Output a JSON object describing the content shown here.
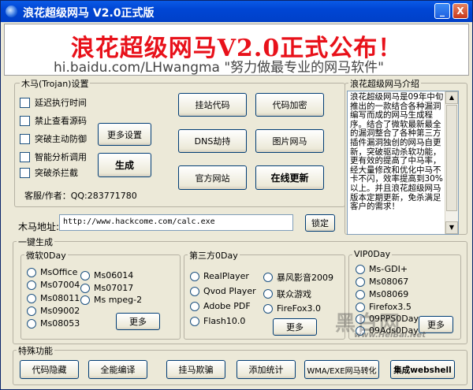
{
  "window": {
    "title": "浪花超级网马 V2.0正式版",
    "minimize_glyph": "_",
    "close_glyph": "X"
  },
  "banner": {
    "headline": "浪花超级网马V2.0正式公布！",
    "subline": "hi.baidu.com/LHwangma  \"努力做最专业的网马软件\"",
    "headline_color": "#e8111a"
  },
  "trojan_settings": {
    "legend": "木马(Trojan)设置",
    "options": [
      {
        "label": "延迟执行时间",
        "checked": false
      },
      {
        "label": "禁止查看源码",
        "checked": false
      },
      {
        "label": "突破主动防御",
        "checked": false
      },
      {
        "label": "智能分析调用",
        "checked": false
      },
      {
        "label": "突破杀拦截",
        "checked": false
      }
    ],
    "more_settings": "更多设置",
    "generate": "生成",
    "author": "客服/作者：QQ:283771780"
  },
  "tools": {
    "hang_code": "挂站代码",
    "encrypt_code": "代码加密",
    "dns_hijack": "DNS劫持",
    "image_trojan": "图片网马",
    "official_site": "官方网站",
    "online_update": "在线更新"
  },
  "intro": {
    "legend": "浪花超级网马介绍",
    "text": "浪花超级网马是09年中旬推出的一款结合各种漏洞编写而成的网马生成程序。结合了微软最新最全的漏洞整合了各种第三方插件漏洞独创的网马自更新，突破驱动杀软功能，更有效的提高了中马率，经大量修改和优化中马不卡不闪，效率提高到30%以上。并且浪花超级网马版本定期更新，免杀满足客户的需求！"
  },
  "trojan_address": {
    "label": "木马地址:",
    "value": "http://www.hackcome.com/calc.exe",
    "lock": "锁定"
  },
  "one_click": {
    "legend": "一键生成",
    "microsoft": {
      "legend": "微软0Day",
      "items": [
        "MsOffice",
        "Ms06014",
        "Ms07004",
        "Ms07017",
        "Ms08011",
        "Ms mpeg-2",
        "Ms09002",
        "Ms08053"
      ],
      "more": "更多"
    },
    "third_party": {
      "legend": "第三方0Day",
      "items": [
        "RealPlayer",
        "暴风影音2009",
        "Qvod Player",
        "联众游戏",
        "Adobe PDF",
        "FireFox3.0",
        "Flash10.0"
      ],
      "more": "更多"
    },
    "vip": {
      "legend": "VIP0Day",
      "items": [
        "Ms-GDI+",
        "Ms08067",
        "Ms08069",
        "Firefox3.5",
        "09PPS0Day",
        "09Ads0Day"
      ],
      "more": "更多"
    }
  },
  "special": {
    "legend": "特殊功能",
    "buttons": [
      "代码隐藏",
      "全能编译",
      "挂马欺骗",
      "添加统计",
      "WMA/EXE网马转化",
      "集成webshell"
    ]
  },
  "watermark": {
    "text": "黑白网",
    "url": "www.HeiBai.Net"
  }
}
